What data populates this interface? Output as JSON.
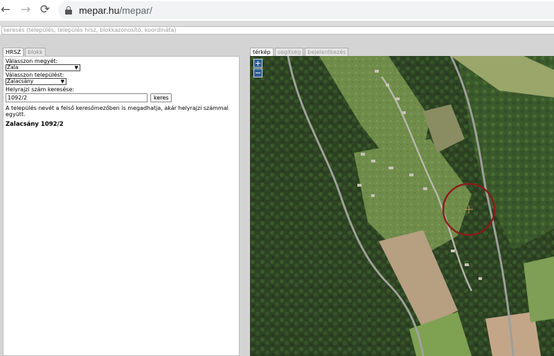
{
  "browser": {
    "back_icon": "←",
    "forward_icon": "→",
    "reload_icon": "⟳",
    "url_host": "mepar.hu",
    "url_path": "/mepar/"
  },
  "search": {
    "placeholder": "keresés (település, település hrsz, blokkazonosító, koordináta)"
  },
  "left_tabs": [
    {
      "label": "HRSZ",
      "active": true
    },
    {
      "label": "blokk",
      "active": false
    }
  ],
  "form": {
    "county_label": "Válasszon megyét:",
    "county_value": "Zala",
    "town_label": "Válasszon települést:",
    "town_value": "Zalacsány",
    "hrsz_label": "Helyrajzi szám keresése:",
    "hrsz_value": "1092/2",
    "search_button": "keres",
    "hint": "A település nevét a felső keresőmezőben is megadhatja, akár helyrajzi számmal együtt.",
    "result": "Zalacsány 1092/2"
  },
  "map_tabs": [
    {
      "label": "térkép",
      "active": true
    },
    {
      "label": "segítség",
      "active": false
    },
    {
      "label": "bejelentkezés",
      "active": false
    }
  ],
  "map": {
    "zoom_in": "+",
    "zoom_out": "−",
    "highlight_color": "#8b1a1a"
  }
}
